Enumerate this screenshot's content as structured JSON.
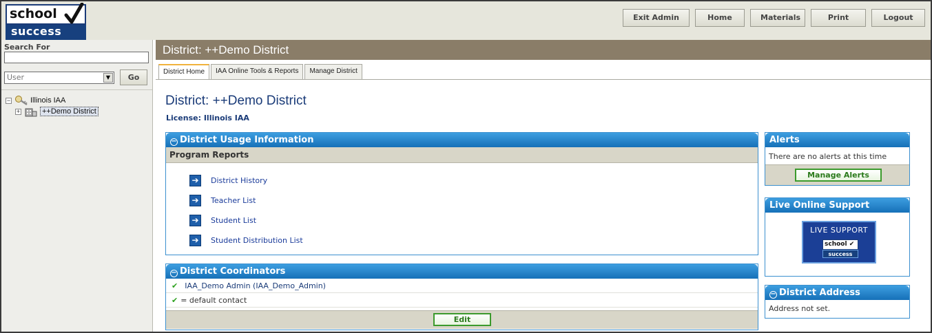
{
  "logo": {
    "top": "school",
    "bottom": "success"
  },
  "nav": {
    "buttons": [
      "Exit Admin",
      "Home",
      "Materials",
      "Print",
      "Logout"
    ]
  },
  "sidebar": {
    "search_label": "Search For",
    "search_value": "",
    "select_value": "User",
    "go_label": "Go",
    "tree": {
      "root": "Illinois IAA",
      "child": "++Demo District"
    }
  },
  "main": {
    "header": "District: ++Demo District",
    "tabs": [
      "District Home",
      "IAA Online Tools & Reports",
      "Manage District"
    ],
    "title": "District: ++Demo District",
    "license": "License: Illinois IAA"
  },
  "usage": {
    "title": "District Usage Information",
    "subhead": "Program Reports",
    "reports": [
      "District History",
      "Teacher List",
      "Student List",
      "Student Distribution List"
    ]
  },
  "coordinators": {
    "title": "District Coordinators",
    "admin": "IAA_Demo Admin (IAA_Demo_Admin)",
    "legend": "= default contact",
    "edit_label": "Edit"
  },
  "alerts": {
    "title": "Alerts",
    "message": "There are no alerts at this time",
    "button": "Manage Alerts"
  },
  "support": {
    "title": "Live Online Support",
    "banner_text": "LIVE SUPPORT",
    "logo_top": "school",
    "logo_bottom": "success"
  },
  "address": {
    "title": "District Address",
    "message": "Address not set."
  },
  "colors": {
    "panel_header": "#1670b8",
    "district_bar": "#8a7d68",
    "accent_tab": "#f0b23c",
    "check_green": "#2da11e"
  }
}
